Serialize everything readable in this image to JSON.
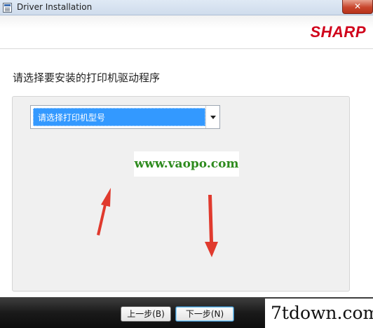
{
  "window": {
    "title": "Driver Installation",
    "close_label": "✕"
  },
  "header": {
    "brand": "SHARP",
    "brand_color": "#d0021b"
  },
  "main": {
    "instruction": "请选择要安装的打印机驱动程序",
    "combo": {
      "selected_value": "请选择打印机型号",
      "selected_bg": "#3399ff"
    }
  },
  "overlays": {
    "watermark_text": "www.vaopo.com",
    "watermark_color": "#2e8b1e",
    "arrow_color": "#e03a2e",
    "site_watermark": "7tdown.com"
  },
  "footer": {
    "back_label": "上一步(B)",
    "next_label": "下一步(N)"
  },
  "icons": {
    "app": "app-window-icon",
    "close": "close-icon",
    "dropdown": "chevron-down-icon"
  }
}
